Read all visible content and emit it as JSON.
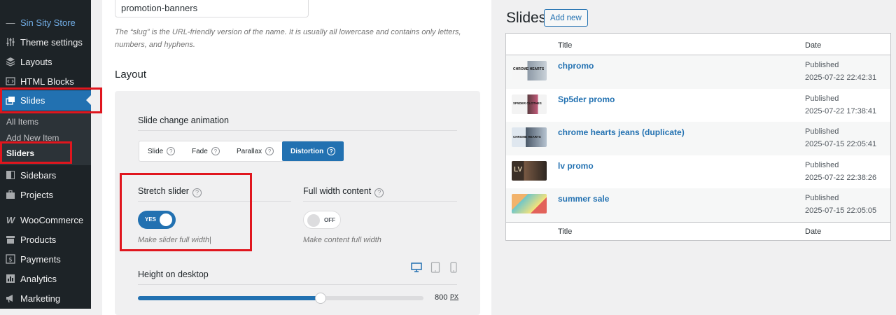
{
  "sidebar": {
    "store_name": "Sin Sity Store",
    "items": [
      {
        "label": "Theme settings",
        "icon": "sliders-icon"
      },
      {
        "label": "Layouts",
        "icon": "layers-icon"
      },
      {
        "label": "HTML Blocks",
        "icon": "code-block-icon"
      },
      {
        "label": "Slides",
        "icon": "slides-icon"
      },
      {
        "label": "Sidebars",
        "icon": "sidebar-icon"
      },
      {
        "label": "Projects",
        "icon": "briefcase-icon"
      },
      {
        "label": "WooCommerce",
        "icon": "woocommerce-icon"
      },
      {
        "label": "Products",
        "icon": "archive-icon"
      },
      {
        "label": "Payments",
        "icon": "dollar-icon"
      },
      {
        "label": "Analytics",
        "icon": "chart-icon"
      },
      {
        "label": "Marketing",
        "icon": "megaphone-icon"
      }
    ],
    "submenu": [
      "All Items",
      "Add New Item",
      "Sliders"
    ]
  },
  "form": {
    "slug_value": "promotion-banners",
    "slug_hint": "The “slug” is the URL-friendly version of the name. It is usually all lowercase and contains only letters, numbers, and hyphens.",
    "layout_title": "Layout",
    "animation_label": "Slide change animation",
    "animation_options": [
      "Slide",
      "Fade",
      "Parallax",
      "Distortion"
    ],
    "animation_selected": "Distortion",
    "stretch_label": "Stretch slider",
    "stretch_state": "YES",
    "stretch_help": "Make slider full width",
    "fullwidth_label": "Full width content",
    "fullwidth_state": "OFF",
    "fullwidth_help": "Make content full width",
    "height_label": "Height on desktop",
    "height_value": "800",
    "height_unit": "PX",
    "height_fraction": 0.64,
    "accent_color": "#2271b1"
  },
  "slides": {
    "title": "Slides",
    "add_new_label": "Add new",
    "col_title": "Title",
    "col_date": "Date",
    "rows": [
      {
        "title": "chpromo",
        "status": "Published",
        "date": "2025-07-22 22:42:31",
        "thumb_text": "CHROME HEARTS"
      },
      {
        "title": "Sp5der promo",
        "status": "Published",
        "date": "2025-07-22 17:38:41",
        "thumb_text": "SP5DER CLOTHES"
      },
      {
        "title": "chrome hearts jeans (duplicate)",
        "status": "Published",
        "date": "2025-07-15 22:05:41",
        "thumb_text": "CHROME HEARTS"
      },
      {
        "title": "lv promo",
        "status": "Published",
        "date": "2025-07-22 22:38:26",
        "thumb_text": "LV"
      },
      {
        "title": "summer sale",
        "status": "Published",
        "date": "2025-07-15 22:05:05",
        "thumb_text": ""
      }
    ]
  }
}
